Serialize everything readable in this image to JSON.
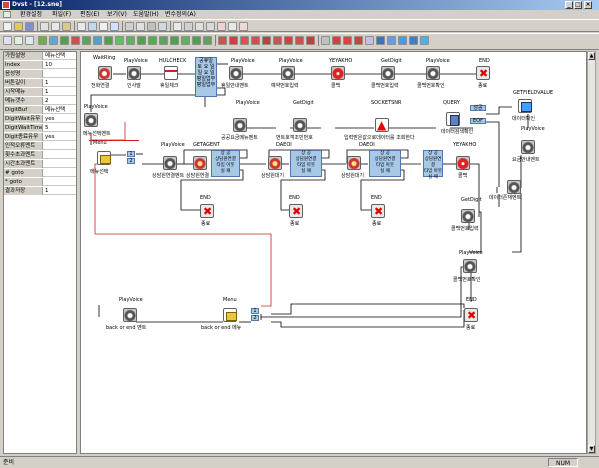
{
  "window": {
    "title": "Dvst - [12.sne]"
  },
  "menu": [
    "환경설정",
    "파일(F)",
    "편집(E)",
    "보기(V)",
    "도움말(H)",
    "변수정의(A)"
  ],
  "properties": [
    {
      "k": "가원설명",
      "v": "메뉴선택"
    },
    {
      "k": "Index",
      "v": "10"
    },
    {
      "k": "음성명",
      "v": ""
    },
    {
      "k": "버튼길이",
      "v": "1"
    },
    {
      "k": "시작메뉴",
      "v": "1"
    },
    {
      "k": "메뉴갯수",
      "v": "2"
    },
    {
      "k": "DigitBuf",
      "v": "메뉴선택"
    },
    {
      "k": "DigitWait유무",
      "v": "yes"
    },
    {
      "k": "DigitWaitTime",
      "v": "5"
    },
    {
      "k": "Digit종료유무",
      "v": "yes"
    },
    {
      "k": "인적오류멘트",
      "v": ""
    },
    {
      "k": "횟수초과멘트",
      "v": ""
    },
    {
      "k": "시간초과멘트",
      "v": ""
    },
    {
      "k": "# goto",
      "v": ""
    },
    {
      "k": "* goto",
      "v": ""
    },
    {
      "k": "결과저장",
      "v": "1"
    }
  ],
  "nodes": [
    {
      "id": "n-waitring",
      "type": "WaitRing",
      "caption": "전화연결",
      "icon": "connect"
    },
    {
      "id": "n-play-greet",
      "type": "PlayVoice",
      "caption": "인사말",
      "icon": "play"
    },
    {
      "id": "n-hulcheck",
      "type": "HULCHECK",
      "caption": "휴일체크",
      "icon": "hulcheck"
    },
    {
      "id": "n-play-holiday",
      "type": "PlayVoice",
      "caption": "휴일안내멘트",
      "icon": "play"
    },
    {
      "id": "n-play-reserve-guide",
      "type": "PlayVoice",
      "caption": "예약번호입력",
      "icon": "play"
    },
    {
      "id": "n-yeyakho-1",
      "type": "YEYAKHO",
      "caption": "콜백",
      "icon": "yeyakho"
    },
    {
      "id": "n-getdigit-1",
      "type": "GetDigit",
      "caption": "콜백번호입력",
      "icon": "digit"
    },
    {
      "id": "n-play-callback-confirm",
      "type": "PlayVoice",
      "caption": "콜백번호확인",
      "icon": "play"
    },
    {
      "id": "n-end-1",
      "type": "END",
      "caption": "종료",
      "icon": "end"
    },
    {
      "id": "n-play-menu",
      "type": "PlayVoice",
      "caption": "메뉴선택멘트",
      "icon": "play"
    },
    {
      "id": "n-play-reenter",
      "type": "PlayVoice",
      "caption": "공공요금메뉴멘트",
      "icon": "play"
    },
    {
      "id": "n-getdigit-2",
      "type": "GetDigit",
      "caption": "번트호객조민번호",
      "icon": "digit"
    },
    {
      "id": "n-socketsnr",
      "type": "SOCKETSNR",
      "caption": "입력받은값으로데이터를 조회한다",
      "icon": "socket"
    },
    {
      "id": "n-query",
      "type": "QUERY",
      "caption": "데이터검색확인",
      "icon": "query"
    },
    {
      "id": "n-getfieldvalue",
      "type": "GETFIELDVALUE",
      "caption": "데이터확인",
      "icon": "getfield"
    },
    {
      "id": "n-play-amount",
      "type": "PlayVoice",
      "caption": "요금안내멘트",
      "icon": "play"
    },
    {
      "id": "n-menu-1",
      "type": "Menu",
      "caption": "메뉴선택",
      "icon": "menu"
    },
    {
      "id": "n-play-agent",
      "type": "PlayVoice",
      "caption": "상담원연결멘트",
      "icon": "play"
    },
    {
      "id": "n-getagent",
      "type": "GETAGENT",
      "caption": "상담원연결",
      "icon": "agent"
    },
    {
      "id": "n-daeoi-1",
      "type": "DAEOI",
      "caption": "상담원대기",
      "icon": "agent"
    },
    {
      "id": "n-daeoi-2",
      "type": "DAEOI",
      "caption": "상담원대기",
      "icon": "agent"
    },
    {
      "id": "n-yeyakho-2",
      "type": "YEYAKHO",
      "caption": "콜백",
      "icon": "yeyakho"
    },
    {
      "id": "n-play-data-found",
      "type": "PlayVoice",
      "caption": "데이터존재멘트",
      "icon": "play"
    },
    {
      "id": "n-end-2",
      "type": "END",
      "caption": "종료",
      "icon": "end"
    },
    {
      "id": "n-end-3",
      "type": "END",
      "caption": "종료",
      "icon": "end"
    },
    {
      "id": "n-end-4",
      "type": "END",
      "caption": "종료",
      "icon": "end"
    },
    {
      "id": "n-getdigit-3",
      "type": "GetDigit",
      "caption": "콜백번호입력",
      "icon": "digit"
    },
    {
      "id": "n-play-callback-confirm-2",
      "type": "PlayVoice",
      "caption": "콜백번호확인",
      "icon": "play"
    },
    {
      "id": "n-play-back-end",
      "type": "PlayVoice",
      "caption": "back or end 멘트",
      "icon": "play"
    },
    {
      "id": "n-menu-2",
      "type": "Menu",
      "caption": "back or end 메뉴",
      "icon": "menu"
    },
    {
      "id": "n-end-5",
      "type": "END",
      "caption": "종료",
      "icon": "end"
    }
  ],
  "node_labels": {
    "hulcheck_list": [
      "공휴일",
      "토 요 일",
      "일 요 일",
      "평일업무",
      "평일업무"
    ],
    "agent_box": [
      "상 공",
      "상담원연결",
      "타임 아웃",
      "실 패"
    ],
    "daeoi_1": [
      "상 공",
      "상담원연결",
      "타임 아웃",
      "실 패"
    ],
    "daeoi_2": [
      "상 공",
      "상담원연결",
      "타임 아웃",
      "실 패"
    ],
    "daeoi_3": [
      "상 공",
      "상담원연결",
      "타임 아웃",
      "실 패"
    ],
    "query_ok": "성공",
    "query_eof": "EOF",
    "menu1_ports": [
      "1",
      "2"
    ],
    "menu2_ports": [
      "1",
      "2"
    ]
  },
  "statusbar": {
    "text": "준비",
    "num": "NUM"
  }
}
